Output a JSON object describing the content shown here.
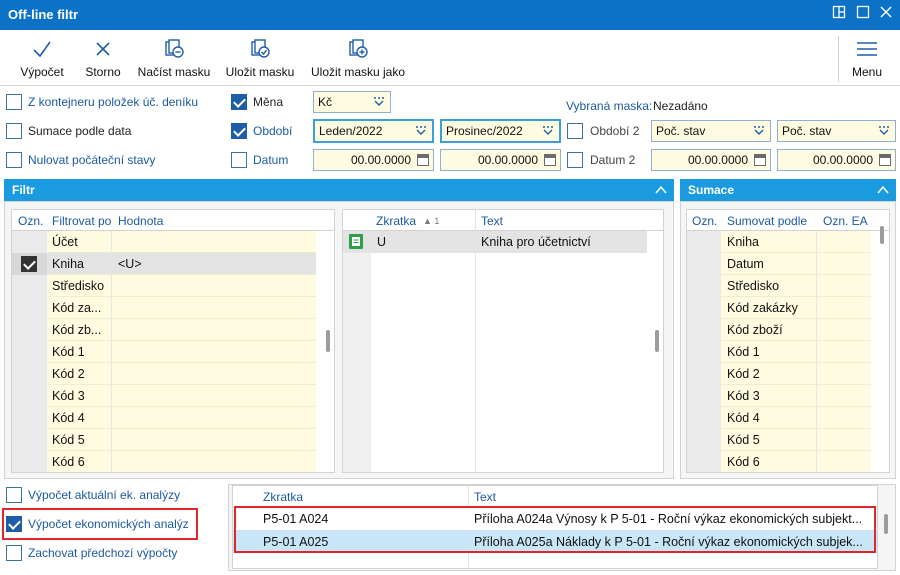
{
  "window": {
    "title": "Off-line filtr"
  },
  "toolbar": {
    "compute": "Výpočet",
    "cancel": "Storno",
    "load_mask": "Načíst masku",
    "save_mask": "Uložit masku",
    "save_mask_as": "Uložit masku jako",
    "menu": "Menu"
  },
  "options": {
    "from_journal": "Z kontejneru položek úč. deníku",
    "sum_by_date": "Sumace podle data",
    "reset_initial": "Nulovat počáteční stavy",
    "currency_label": "Měna",
    "currency_value": "Kč",
    "period_label": "Období",
    "period_from": "Leden/2022",
    "period_to": "Prosinec/2022",
    "date_label": "Datum",
    "date_from": "00.00.0000",
    "date_to": "00.00.0000",
    "selected_mask_label": "Vybraná maska:",
    "selected_mask_value": "Nezadáno",
    "period2_label": "Období 2",
    "period2_from": "Poč. stav",
    "period2_to": "Poč. stav",
    "date2_label": "Datum 2",
    "date2_from": "00.00.0000",
    "date2_to": "00.00.0000"
  },
  "filter_panel": {
    "title": "Filtr",
    "columns": [
      "Ozn.",
      "Filtrovat po",
      "Hodnota"
    ],
    "rows": [
      {
        "name": "Účet",
        "value": "",
        "checked": false
      },
      {
        "name": "Kniha",
        "value": "<U>",
        "checked": true
      },
      {
        "name": "Středisko",
        "value": "",
        "checked": false
      },
      {
        "name": "Kód za...",
        "value": "",
        "checked": false
      },
      {
        "name": "Kód zb...",
        "value": "",
        "checked": false
      },
      {
        "name": "Kód 1",
        "value": "",
        "checked": false
      },
      {
        "name": "Kód 2",
        "value": "",
        "checked": false
      },
      {
        "name": "Kód 3",
        "value": "",
        "checked": false
      },
      {
        "name": "Kód 4",
        "value": "",
        "checked": false
      },
      {
        "name": "Kód 5",
        "value": "",
        "checked": false
      },
      {
        "name": "Kód 6",
        "value": "",
        "checked": false
      }
    ]
  },
  "book_list": {
    "columns": [
      "Zkratka",
      "Text"
    ],
    "sort_indicator": "▲ 1",
    "rows": [
      {
        "code": "U",
        "text": "Kniha pro účetnictví"
      }
    ]
  },
  "sum_panel": {
    "title": "Sumace",
    "columns": [
      "Ozn.",
      "Sumovat podle",
      "Ozn. EA"
    ],
    "rows": [
      "Kniha",
      "Datum",
      "Středisko",
      "Kód zakázky",
      "Kód zboží",
      "Kód 1",
      "Kód 2",
      "Kód 3",
      "Kód 4",
      "Kód 5",
      "Kód 6"
    ]
  },
  "bottom_options": {
    "current_analysis": "Výpočet aktuální ek. analýzy",
    "economic_analysis": "Výpočet ekonomických analýz",
    "keep_previous": "Zachovat předchozí výpočty"
  },
  "analysis_list": {
    "columns": [
      "Zkratka",
      "Text"
    ],
    "rows": [
      {
        "code": "P5-01 A024",
        "text": "Příloha A024a Výnosy k P 5-01 - Roční výkaz ekonomických subjekt..."
      },
      {
        "code": "P5-01 A025",
        "text": "Příloha A025a Náklady k P 5-01 - Roční výkaz ekonomických subjek..."
      }
    ]
  },
  "colors": {
    "title_bar": "#0b72c7",
    "panel_header": "#1a9be0",
    "highlight": "#e0262b",
    "row_yellow": "#fffbe0",
    "selected_row": "#c9e6f8"
  }
}
